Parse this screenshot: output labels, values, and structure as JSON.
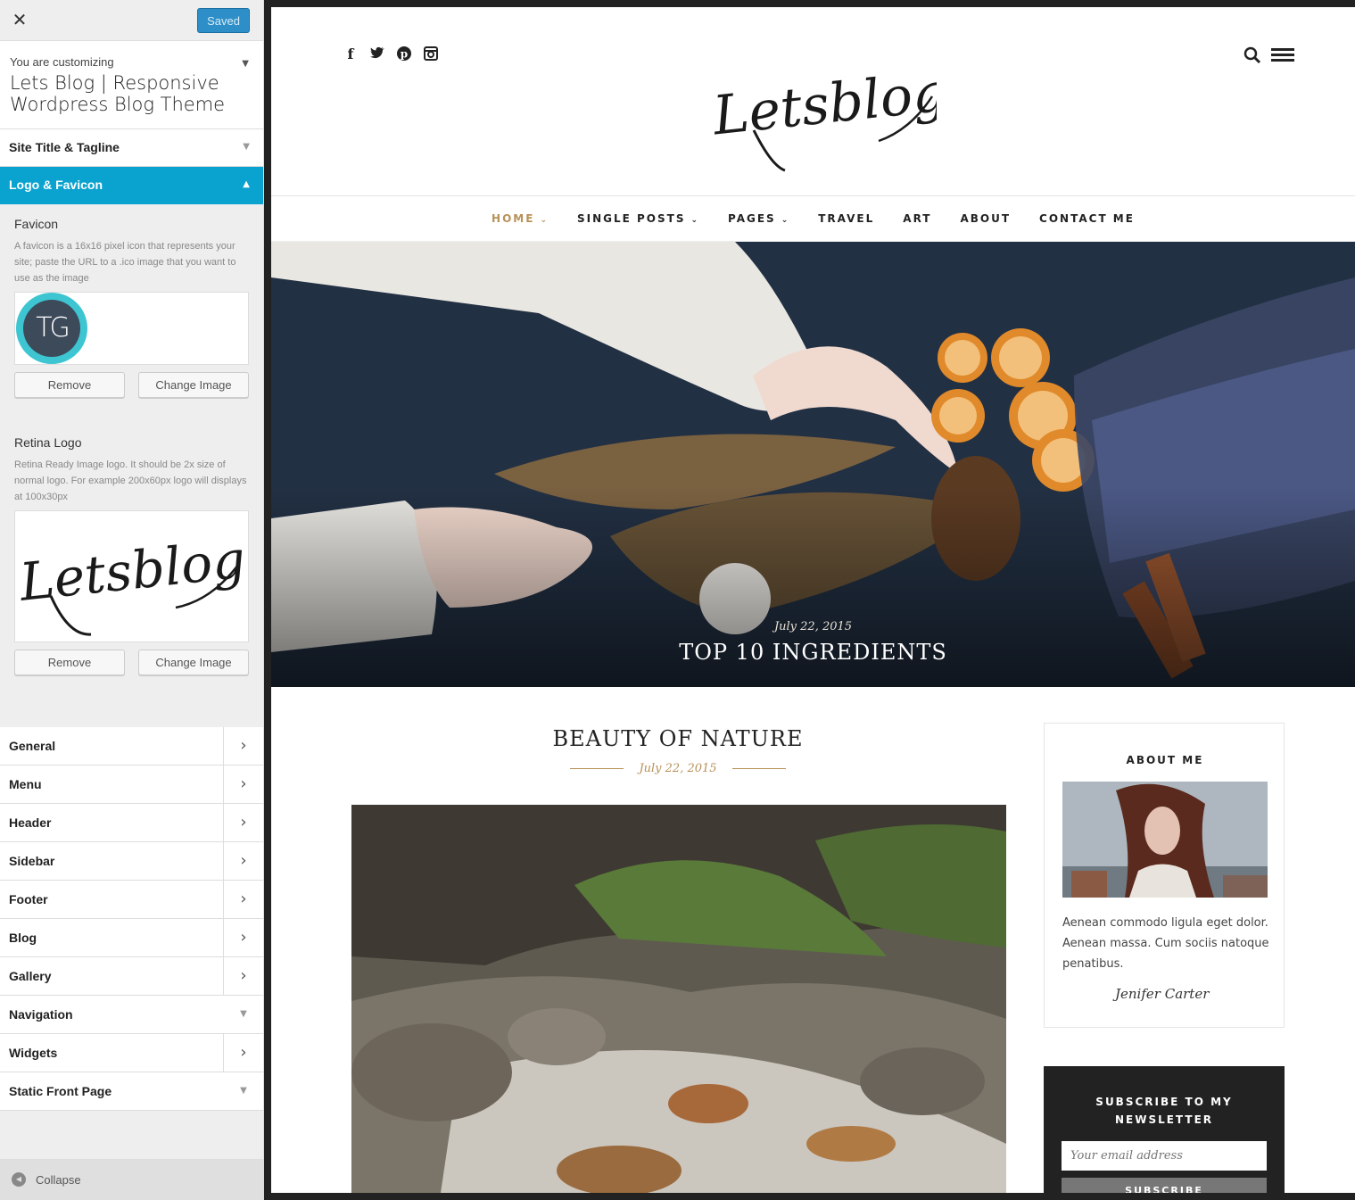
{
  "customizer": {
    "saved_label": "Saved",
    "customizing_label": "You are customizing",
    "theme_title": "Lets Blog | Responsive Wordpress Blog Theme",
    "sections": {
      "site_title": "Site Title & Tagline",
      "logo_favicon": "Logo & Favicon"
    },
    "favicon": {
      "title": "Favicon",
      "description": "A favicon is a 16x16 pixel icon that represents your site; paste the URL to a .ico image that you want to use as the image",
      "logo_text": "TG",
      "remove_label": "Remove",
      "change_label": "Change Image"
    },
    "retina": {
      "title": "Retina Logo",
      "description": "Retina Ready Image logo. It should be 2x size of normal logo. For example 200x60px logo will displays at 100x30px",
      "logo_text": "Letsblog",
      "remove_label": "Remove",
      "change_label": "Change Image"
    },
    "panels": [
      "General",
      "Menu",
      "Header",
      "Sidebar",
      "Footer",
      "Blog",
      "Gallery",
      "Navigation",
      "Widgets",
      "Static Front Page"
    ],
    "collapse_label": "Collapse",
    "accent_color": "#0aa3cf"
  },
  "site": {
    "logo_text": "Letsblog",
    "nav": {
      "home": "HOME",
      "single_posts": "SINGLE POSTS",
      "pages": "PAGES",
      "travel": "TRAVEL",
      "art": "ART",
      "about": "ABOUT",
      "contact": "CONTACT ME"
    },
    "hero": {
      "date": "July 22, 2015",
      "title": "TOP 10 INGREDIENTS"
    },
    "post": {
      "title": "BEAUTY OF NATURE",
      "date": "July 22, 2015"
    },
    "about": {
      "heading": "ABOUT ME",
      "text": "Aenean commodo ligula eget dolor. Aenean massa. Cum sociis natoque penatibus.",
      "signature": "Jenifer Carter"
    },
    "newsletter": {
      "heading_line1": "SUBSCRIBE TO MY",
      "heading_line2": "NEWSLETTER",
      "placeholder": "Your email address",
      "button": "SUBSCRIBE"
    },
    "accent_color": "#b79158"
  }
}
